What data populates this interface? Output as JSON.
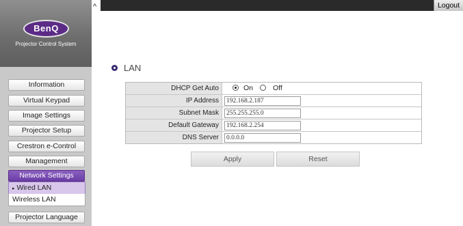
{
  "brand": {
    "logo": "BenQ",
    "subtitle": "Projector Control System"
  },
  "header": {
    "logout_label": "Logout",
    "scroll_glyph": "^"
  },
  "sidebar": {
    "items": [
      {
        "label": "Information"
      },
      {
        "label": "Virtual Keypad"
      },
      {
        "label": "Image Settings"
      },
      {
        "label": "Projector Setup"
      },
      {
        "label": "Crestron e-Control"
      },
      {
        "label": "Management"
      },
      {
        "label": "Network Settings",
        "active": true
      },
      {
        "label": "Projector Language"
      }
    ],
    "network_submenu": [
      {
        "label": "Wired LAN",
        "selected": true
      },
      {
        "label": "Wireless LAN"
      }
    ]
  },
  "main": {
    "section_title": "LAN",
    "dhcp": {
      "label": "DHCP Get Auto",
      "on_label": "On",
      "off_label": "Off",
      "value": "On"
    },
    "fields": [
      {
        "label": "IP Address",
        "value": "192.168.2.187"
      },
      {
        "label": "Subnet Mask",
        "value": "255.255.255.0"
      },
      {
        "label": "Default Gateway",
        "value": "192.168.2.254"
      },
      {
        "label": "DNS Server",
        "value": "0.0.0.0"
      }
    ],
    "apply_label": "Apply",
    "reset_label": "Reset"
  },
  "colors": {
    "accent": "#6a3ea6",
    "topbar": "#2a2a2a",
    "sidebar_bg": "#c9c9c9"
  }
}
